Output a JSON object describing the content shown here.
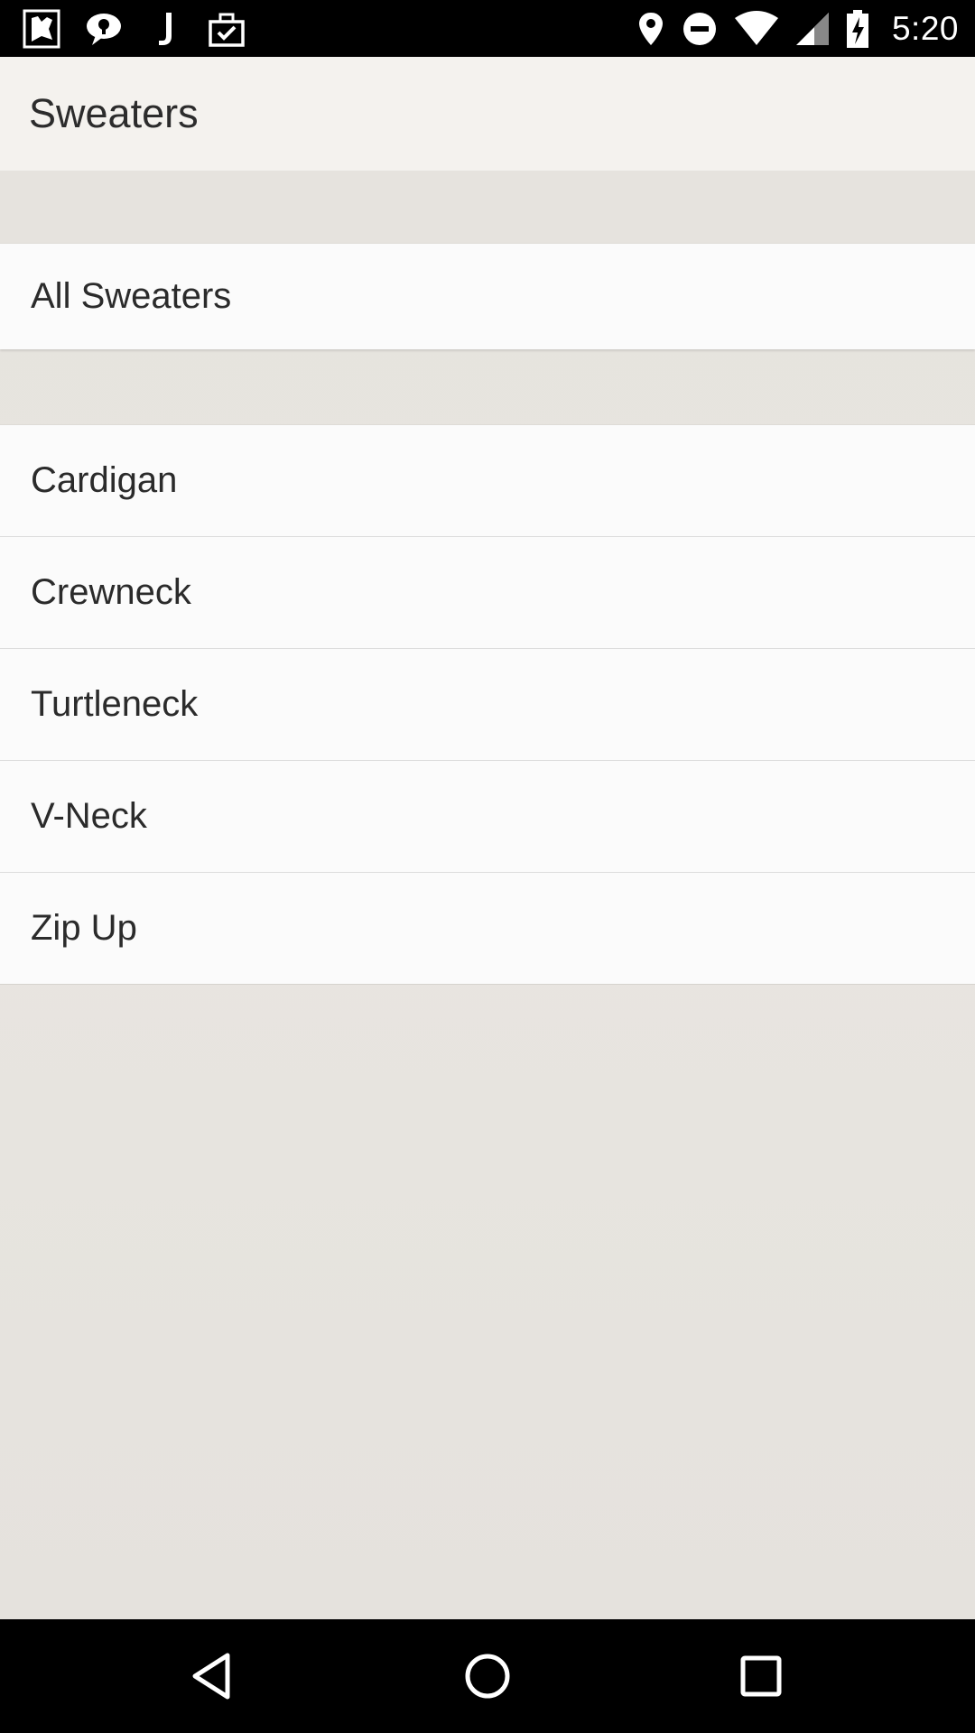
{
  "status_bar": {
    "time": "5:20",
    "left_icons": [
      "map-app-icon",
      "chat-bubble-icon",
      "j-app-icon",
      "briefcase-check-icon"
    ],
    "right_icons": [
      "location-pin-icon",
      "do-not-disturb-icon",
      "wifi-icon",
      "cell-signal-icon",
      "battery-charging-icon"
    ]
  },
  "app_bar": {
    "title": "Sweaters"
  },
  "list": {
    "all_item": "All Sweaters",
    "items": [
      "Cardigan",
      "Crewneck",
      "Turtleneck",
      "V-Neck",
      "Zip Up"
    ]
  },
  "nav_bar": {
    "icons": [
      "back-icon",
      "home-icon",
      "recents-icon"
    ]
  },
  "colors": {
    "app_bar_bg": "#f4f2ee",
    "list_bg": "#fbfbfb",
    "content_bg": "#e8e5e0",
    "system_bars": "#000000"
  }
}
